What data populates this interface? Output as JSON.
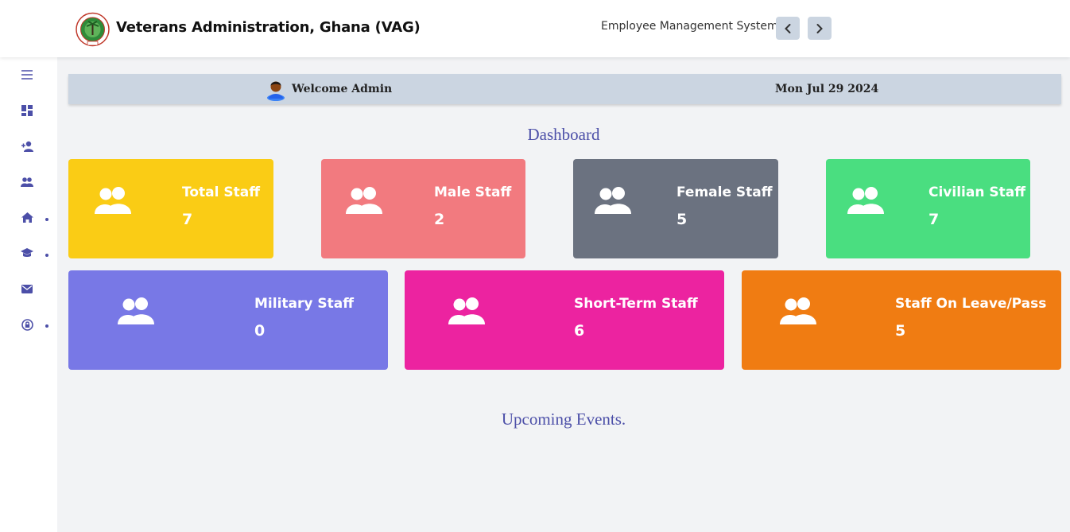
{
  "header": {
    "brand": "Veterans Administration, Ghana (VAG)",
    "subtitle": "Employee Management System"
  },
  "sidebar": {
    "icons": [
      "menu-icon",
      "dashboard-icon",
      "add-user-icon",
      "users-icon",
      "home-icon",
      "graduation-cap-icon",
      "mail-icon",
      "lock-icon"
    ]
  },
  "welcome": {
    "greeting": "Welcome Admin",
    "date": "Mon Jul 29 2024"
  },
  "dashboard": {
    "title": "Dashboard",
    "cards": [
      {
        "label": "Total Staff",
        "value": "7",
        "color": "#facc15"
      },
      {
        "label": "Male Staff",
        "value": "2",
        "color": "#f27a7f"
      },
      {
        "label": "Female Staff",
        "value": "5",
        "color": "#6b7280"
      },
      {
        "label": "Civilian Staff",
        "value": "7",
        "color": "#4ade80"
      },
      {
        "label": "Military Staff",
        "value": "0",
        "color": "#7878e6"
      },
      {
        "label": "Short-Term Staff",
        "value": "6",
        "color": "#ec23a0"
      },
      {
        "label": "Staff On Leave/Pass",
        "value": "5",
        "color": "#f07c12"
      }
    ]
  },
  "events": {
    "title": "Upcoming Events."
  }
}
